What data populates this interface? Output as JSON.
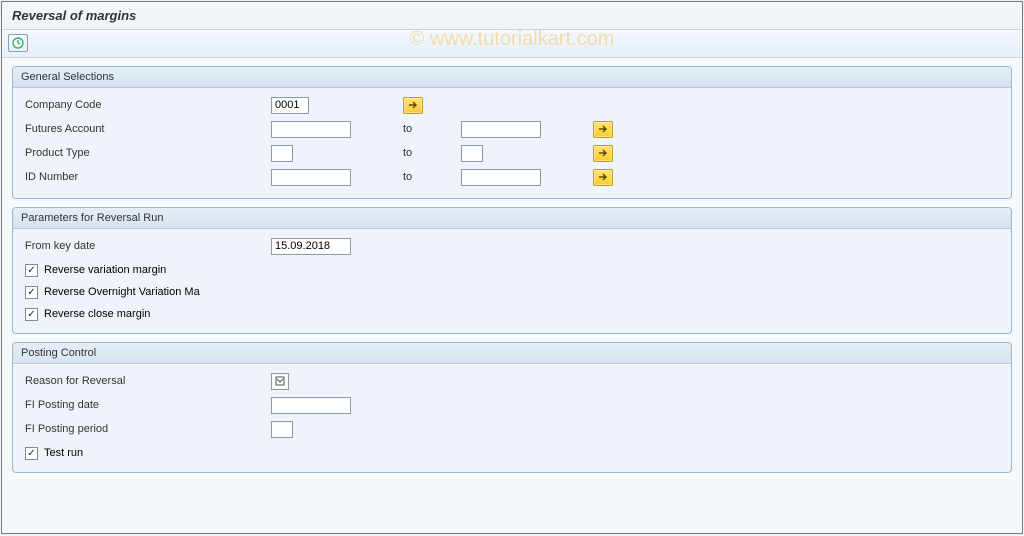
{
  "title": "Reversal of margins",
  "watermark": "© www.tutorialkart.com",
  "groups": {
    "general": {
      "title": "General Selections",
      "company_code_label": "Company Code",
      "company_code_value": "0001",
      "futures_account_label": "Futures Account",
      "futures_account_from": "",
      "futures_account_to": "",
      "product_type_label": "Product Type",
      "product_type_from": "",
      "product_type_to": "",
      "id_number_label": "ID Number",
      "id_number_from": "",
      "id_number_to": "",
      "to_label": "to"
    },
    "params": {
      "title": "Parameters for Reversal Run",
      "from_key_date_label": "From key date",
      "from_key_date_value": "15.09.2018",
      "rev_var_margin_label": "Reverse variation margin",
      "rev_var_margin_checked": true,
      "rev_overnight_label": "Reverse Overnight Variation Ma",
      "rev_overnight_checked": true,
      "rev_close_label": "Reverse close margin",
      "rev_close_checked": true
    },
    "posting": {
      "title": "Posting Control",
      "reason_label": "Reason for Reversal",
      "reason_value": "",
      "fi_date_label": "FI Posting date",
      "fi_date_value": "",
      "fi_period_label": "FI Posting period",
      "fi_period_value": "",
      "test_run_label": "Test run",
      "test_run_checked": true
    }
  }
}
